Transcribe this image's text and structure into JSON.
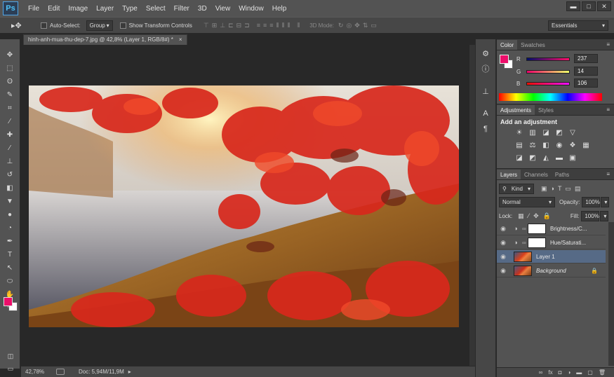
{
  "app": {
    "logo": "Ps"
  },
  "menu": [
    "File",
    "Edit",
    "Image",
    "Layer",
    "Type",
    "Select",
    "Filter",
    "3D",
    "View",
    "Window",
    "Help"
  ],
  "window_controls": {
    "minimize": "▬",
    "maximize": "□",
    "close": "✕"
  },
  "options_bar": {
    "auto_select_label": "Auto-Select:",
    "auto_select_value": "Group",
    "transform_label": "Show Transform Controls",
    "mode_3d_label": "3D Mode:",
    "workspace": "Essentials"
  },
  "document_tab": {
    "title": "hinh-anh-mua-thu-dep-7.jpg @ 42,8% (Layer 1, RGB/8#) *",
    "close": "×"
  },
  "status_bar": {
    "zoom": "42,78%",
    "doc": "Doc: 5,94M/11,9M"
  },
  "colors": {
    "foreground": "#ed0e6a",
    "background": "#ffffff",
    "accent": "#566a86"
  },
  "color_panel": {
    "tabs": [
      "Color",
      "Swatches"
    ],
    "channels": [
      {
        "label": "R",
        "value": "237"
      },
      {
        "label": "G",
        "value": "14"
      },
      {
        "label": "B",
        "value": "106"
      }
    ]
  },
  "adjustments_panel": {
    "tabs": [
      "Adjustments",
      "Styles"
    ],
    "title": "Add an adjustment"
  },
  "layers_panel": {
    "tabs": [
      "Layers",
      "Channels",
      "Paths"
    ],
    "kind_label": "Kind",
    "blend_mode": "Normal",
    "opacity_label": "Opacity:",
    "opacity_value": "100%",
    "lock_label": "Lock:",
    "fill_label": "Fill:",
    "fill_value": "100%",
    "layers": [
      {
        "name": "Brightness/C...",
        "type": "adjustment"
      },
      {
        "name": "Hue/Saturati...",
        "type": "adjustment"
      },
      {
        "name": "Layer 1",
        "type": "image",
        "selected": true
      },
      {
        "name": "Background",
        "type": "image",
        "locked": true
      }
    ],
    "footer_icons": [
      "link-icon",
      "fx-icon",
      "mask-icon",
      "adjustment-icon",
      "folder-icon",
      "new-layer-icon",
      "trash-icon"
    ]
  }
}
